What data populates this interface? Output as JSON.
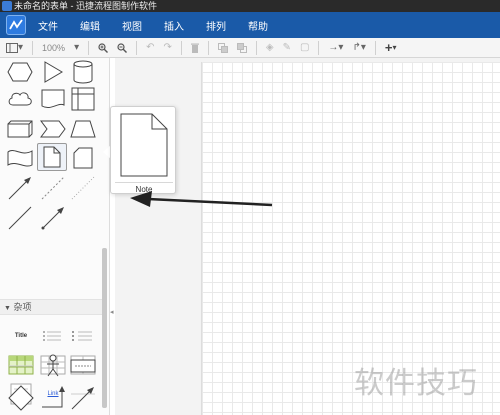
{
  "window": {
    "title": "未命名的表单 - 迅捷流程图制作软件",
    "app_icon": "flowchart-app-icon"
  },
  "menubar": {
    "logo_icon": "zigzag-logo-icon",
    "items": [
      "文件",
      "编辑",
      "视图",
      "插入",
      "排列",
      "帮助"
    ]
  },
  "toolbar": {
    "zoom": "100%",
    "icons": [
      "page-layout-icon",
      "zoom-in-icon",
      "zoom-out-icon",
      "undo-icon",
      "redo-icon",
      "delete-icon",
      "to-front-icon",
      "to-back-icon",
      "fill-color-icon",
      "line-color-icon",
      "shadow-icon",
      "connection-icon",
      "waypoints-icon",
      "insert-icon"
    ]
  },
  "sidebar": {
    "section_misc_label": "杂项",
    "misc_title_label": "Title",
    "misc_link_label": "Link",
    "misc_note_label": "Note"
  },
  "tooltip": {
    "shape_name": "Note"
  },
  "watermark": "软件技巧",
  "colors": {
    "menubar": "#1a5aa8",
    "titlebar": "#2a2a2a",
    "accent": "#2e7be0"
  }
}
